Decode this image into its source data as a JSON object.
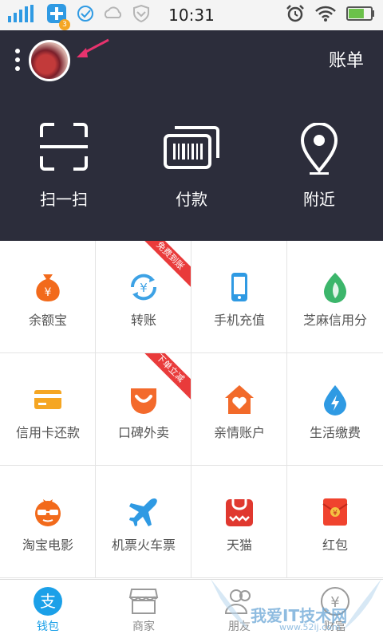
{
  "status_bar": {
    "time": "10:31",
    "notification_badge": "3",
    "battery_level": 0.7
  },
  "header": {
    "bill_label": "账单"
  },
  "actions": [
    {
      "label": "扫一扫",
      "icon": "scan-icon"
    },
    {
      "label": "付款",
      "icon": "payment-code-icon"
    },
    {
      "label": "附近",
      "icon": "location-pin-icon"
    }
  ],
  "grid": [
    {
      "label": "余额宝",
      "icon": "money-bag-icon",
      "color": "#f26a1b"
    },
    {
      "label": "转账",
      "icon": "transfer-icon",
      "color": "#3da2e5",
      "ribbon": "免费到账"
    },
    {
      "label": "手机充值",
      "icon": "phone-icon",
      "color": "#2f9ae3"
    },
    {
      "label": "芝麻信用分",
      "icon": "sesame-icon",
      "color": "#3cb66b"
    },
    {
      "label": "信用卡还款",
      "icon": "credit-card-icon",
      "color": "#f5a623"
    },
    {
      "label": "口碑外卖",
      "icon": "smile-bag-icon",
      "color": "#f36a2c",
      "ribbon": "下单立减"
    },
    {
      "label": "亲情账户",
      "icon": "heart-house-icon",
      "color": "#f26a2a"
    },
    {
      "label": "生活缴费",
      "icon": "water-drop-icon",
      "color": "#2f9ae3"
    },
    {
      "label": "淘宝电影",
      "icon": "glasses-face-icon",
      "color": "#f26a1b"
    },
    {
      "label": "机票火车票",
      "icon": "airplane-icon",
      "color": "#2f9ae3"
    },
    {
      "label": "天猫",
      "icon": "tmall-bag-icon",
      "color": "#e0382f"
    },
    {
      "label": "红包",
      "icon": "red-envelope-icon",
      "color": "#f0432e"
    }
  ],
  "bottom_nav": [
    {
      "label": "钱包",
      "icon": "wallet-icon",
      "active": true
    },
    {
      "label": "商家",
      "icon": "shop-icon",
      "active": false
    },
    {
      "label": "朋友",
      "icon": "friends-icon",
      "active": false
    },
    {
      "label": "财富",
      "icon": "yen-icon",
      "active": false
    }
  ],
  "watermark": {
    "text": "我爱IT技术网",
    "url_text": "www.52ij.com"
  },
  "colors": {
    "header_bg": "#2c2d3b",
    "accent": "#1ba0e8",
    "ribbon": "#e93b3b"
  }
}
